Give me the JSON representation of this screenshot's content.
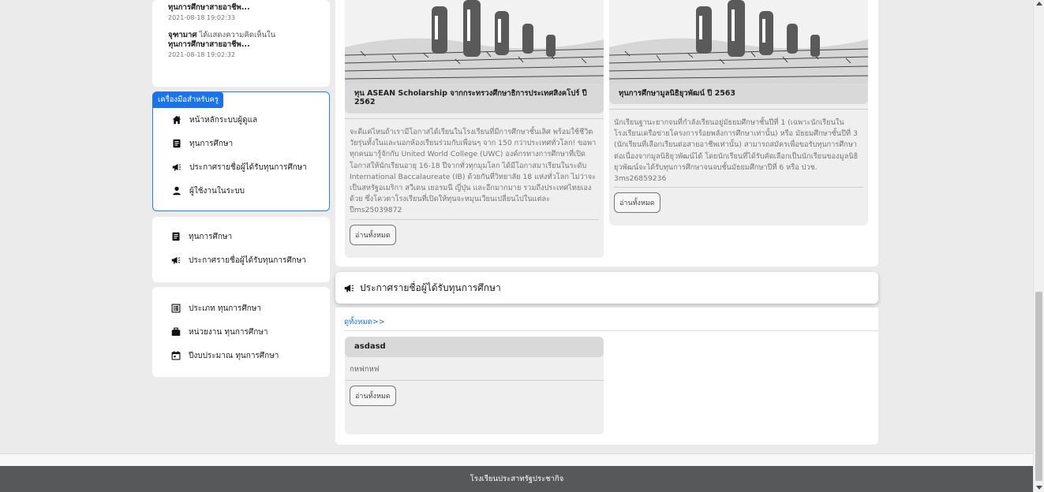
{
  "activity": [
    {
      "name": "",
      "action": "",
      "target": "ทุนการศึกษาสายอาชีพ...",
      "time": "2021-08-18 19:02:33"
    },
    {
      "name": "จุฑามาศ",
      "action": "ได้แสดงความคิดเห็นใน",
      "target": "ทุนการศึกษาสายอาชีพ...",
      "time": "2021-08-18 19:02:32"
    }
  ],
  "tools": {
    "badge": "เครื่องมือสำหรับครู",
    "items": [
      {
        "label": "หน้าหลักระบบผู้ดูแล",
        "icon": "home-icon"
      },
      {
        "label": "ทุนการศึกษา",
        "icon": "document-icon"
      },
      {
        "label": "ประกาศรายชื่อผู้ได้รับทุนการศึกษา",
        "icon": "megaphone-icon"
      },
      {
        "label": "ผู้ใช้งานในระบบ",
        "icon": "user-icon"
      }
    ]
  },
  "menu2": [
    {
      "label": "ทุนการศึกษา",
      "icon": "document-icon"
    },
    {
      "label": "ประกาศรายชื่อผู้ได้รับทุนการศึกษา",
      "icon": "megaphone-icon"
    }
  ],
  "menu3": [
    {
      "label": "ประเภท ทุนการศึกษา",
      "icon": "list-icon"
    },
    {
      "label": "หน่วยงาน ทุนการศึกษา",
      "icon": "briefcase-icon"
    },
    {
      "label": "ปีงบประมาณ ทุนการศึกษา",
      "icon": "calendar-icon"
    }
  ],
  "scholarships": [
    {
      "title": "ทุน ASEAN Scholarship จากกระทรวงศึกษาธิการประเทศสิงคโปร์ ปี 2562",
      "body": "จะดีแค่ไหนถ้าเรามีโอกาสได้เรียนในโรงเรียนที่มีการศึกษาชั้นเลิศ พร้อมใช้ชีวิตวัยรุ่นทั้งในและนอกห้องเรียนร่วมกับเพื่อนๆ จาก 150 กว่าประเทศทั่วโลก! ขอพาทุกคนมารู้จักกับ United World College (UWC) องค์กรทางการศึกษาที่เปิดโอกาสให้นักเรียนอายุ 16-18 ปีจากทั่วทุกมุมโลก ได้มีโอกาสมาเรียนในระดับ International Baccalaureate (IB) ด้วยกันที่วิทยาลัย 18 แห่งทั่วโลก ไม่ว่าจะเป็นสหรัฐอเมริกา สวีเดน เยอรมนี ญี่ปุ่น และอีกมากมาย รวมถึงประเทศไทยเองด้วย ซึ่งโควตาโรงเรียนที่เปิดให้ทุนจะหมุนเวียนเปลี่ยนไปในแต่ละปีms25039872",
      "button": "อ่านทั้งหมด"
    },
    {
      "title": "ทุนการศึกษามูลนิธิยุวพัฒน์ ปี 2563",
      "body": "นักเรียนฐานะยากจนที่กำลังเรียนอยู่มัธยมศึกษาชั้นปีที่ 1 (เฉพาะนักเรียนในโรงเรียนเครือข่ายโครงการร้อยพลังการศึกษาเท่านั้น) หรือ มัธยมศึกษาชั้นปีที่ 3 (นักเรียนที่เลือกเรียนต่อสายอาชีพเท่านั้น) สามารถสมัครเพื่อขอรับทุนการศึกษาต่อเนื่องจากมูลนิธิยุวพัฒน์ได้ โดยนักเรียนที่ได้รับคัดเลือกเป็นนักเรียนของมูลนิธิยุวพัฒน์จะได้รับทุนการศึกษาจนจบชั้นมัธยมศึกษาปีที่ 6 หรือ ปวช. 3ms26859236",
      "button": "อ่านทั้งหมด"
    }
  ],
  "announcement": {
    "header": "ประกาศรายชื่อผู้ได้รับทุนการศึกษา",
    "see_all": "ดูทั้งหมด>>",
    "card": {
      "title": "asdasd",
      "text": "กหฟกหฟ",
      "button": "อ่านทั้งหมด"
    }
  },
  "footer": {
    "text": "โรงเรียนประสาทรัฐประชากิจ"
  },
  "colors": {
    "accent": "#1a73e8",
    "footer_bg": "#565859",
    "card_bg": "#efefef",
    "card_title_bg": "#d9d9d9"
  }
}
